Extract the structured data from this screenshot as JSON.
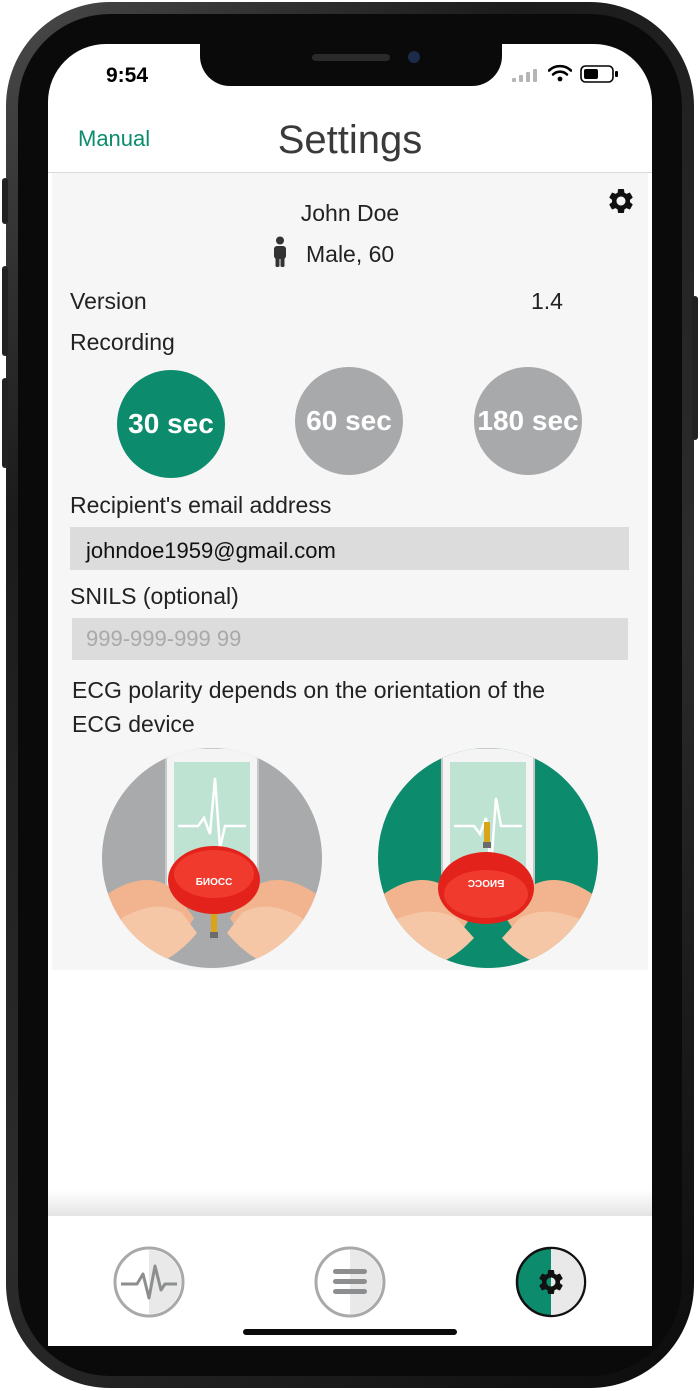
{
  "status_bar": {
    "time": "9:54"
  },
  "nav": {
    "left_label": "Manual",
    "title": "Settings"
  },
  "profile": {
    "name": "John Doe",
    "gender_age": "Male, 60"
  },
  "version": {
    "label": "Version",
    "value": "1.4"
  },
  "recording": {
    "label": "Recording",
    "options": [
      "30 sec",
      "60 sec",
      "180 sec"
    ],
    "selected": "30 sec"
  },
  "email": {
    "label": "Recipient's email address",
    "value": "johndoe1959@gmail.com"
  },
  "snils": {
    "label": "SNILS (optional)",
    "placeholder": "999-999-999 99"
  },
  "ecg": {
    "text": "ECG polarity depends on the orientation of the ECG device"
  },
  "colors": {
    "accent": "#0c8c6c",
    "inactive": "#a8a9ab",
    "device": "#e3231b"
  },
  "tabbar": {
    "items": [
      "ecg-icon",
      "menu-icon",
      "settings-icon"
    ],
    "active": "settings-icon"
  }
}
